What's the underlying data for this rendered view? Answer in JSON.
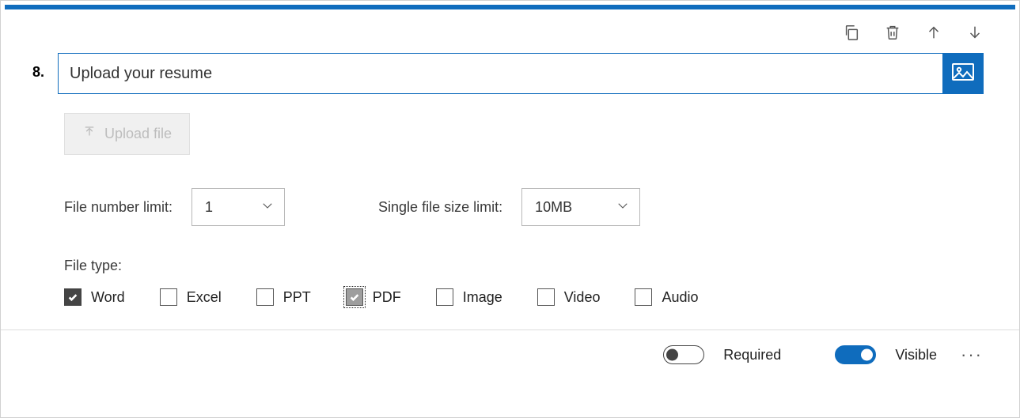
{
  "colors": {
    "accent": "#0f6cbd"
  },
  "question": {
    "number": "8.",
    "title": "Upload your resume"
  },
  "upload_button_label": "Upload file",
  "limits": {
    "file_number_label": "File number limit:",
    "file_number_value": "1",
    "file_size_label": "Single file size limit:",
    "file_size_value": "10MB"
  },
  "filetype": {
    "label": "File type:",
    "options": [
      {
        "label": "Word",
        "checked": true,
        "focused": false
      },
      {
        "label": "Excel",
        "checked": false,
        "focused": false
      },
      {
        "label": "PPT",
        "checked": false,
        "focused": false
      },
      {
        "label": "PDF",
        "checked": true,
        "focused": true
      },
      {
        "label": "Image",
        "checked": false,
        "focused": false
      },
      {
        "label": "Video",
        "checked": false,
        "focused": false
      },
      {
        "label": "Audio",
        "checked": false,
        "focused": false
      }
    ]
  },
  "footer": {
    "required_label": "Required",
    "required_on": false,
    "visible_label": "Visible",
    "visible_on": true
  }
}
